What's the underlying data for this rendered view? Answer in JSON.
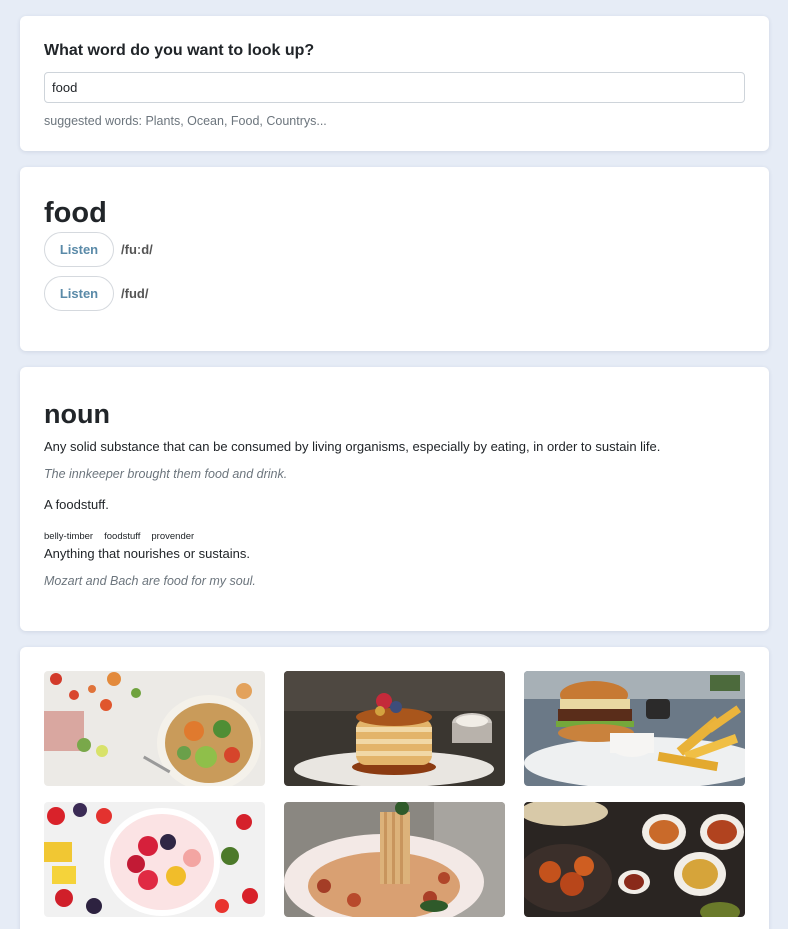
{
  "search": {
    "heading": "What word do you want to look up?",
    "value": "food",
    "suggested": "suggested words: Plants, Ocean, Food, Countrys..."
  },
  "word": {
    "title": "food",
    "phonetics": [
      {
        "listen_label": "Listen",
        "text": "/fuːd/"
      },
      {
        "listen_label": "Listen",
        "text": "/fud/"
      }
    ]
  },
  "meaning": {
    "part_of_speech": "noun",
    "definitions": [
      {
        "text": "Any solid substance that can be consumed by living organisms, especially by eating, in order to sustain life.",
        "example": "The innkeeper brought them food and drink."
      },
      {
        "text": "A foodstuff.",
        "synonyms": [
          "belly-timber",
          "foodstuff",
          "provender"
        ]
      },
      {
        "text": "Anything that nourishes or sustains.",
        "example": "Mozart and Bach are food for my soul."
      }
    ]
  },
  "images": {
    "items": [
      {
        "icon": "salad-bowl-photo"
      },
      {
        "icon": "pancakes-photo"
      },
      {
        "icon": "burger-fries-photo"
      },
      {
        "icon": "fruit-bowl-photo"
      },
      {
        "icon": "spaghetti-photo"
      },
      {
        "icon": "indian-dishes-photo"
      }
    ]
  },
  "colors": {
    "page_bg": "#e6ecf6",
    "card_bg": "#ffffff",
    "listen_text": "#5a8aa8",
    "muted_text": "#6c757d"
  }
}
